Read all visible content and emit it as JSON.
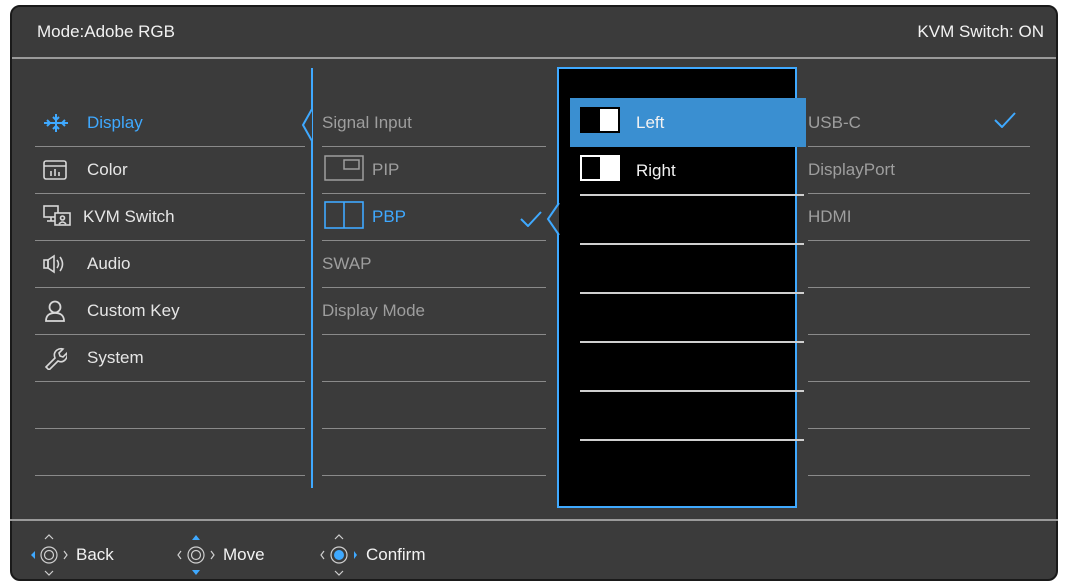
{
  "header": {
    "mode": "Mode:Adobe RGB",
    "kvm_status": "KVM Switch: ON"
  },
  "menu": [
    {
      "label": "Display",
      "icon": "display-icon",
      "active": true
    },
    {
      "label": "Color",
      "icon": "color-icon"
    },
    {
      "label": "KVM Switch",
      "icon": "kvm-switch-icon"
    },
    {
      "label": "Audio",
      "icon": "audio-icon"
    },
    {
      "label": "Custom Key",
      "icon": "user-icon"
    },
    {
      "label": "System",
      "icon": "wrench-icon"
    }
  ],
  "submenu": [
    {
      "label": "Signal Input"
    },
    {
      "label": "PIP",
      "icon": "pip-icon"
    },
    {
      "label": "PBP",
      "icon": "pbp-icon",
      "active": true,
      "checked": true
    },
    {
      "label": "SWAP"
    },
    {
      "label": "Display Mode"
    }
  ],
  "options": [
    {
      "label": "Left",
      "icon": "pbp-left-icon",
      "selected": true
    },
    {
      "label": "Right",
      "icon": "pbp-right-icon"
    }
  ],
  "sources": [
    {
      "label": "USB-C",
      "checked": true
    },
    {
      "label": "DisplayPort"
    },
    {
      "label": "HDMI"
    }
  ],
  "footer": {
    "back": "Back",
    "move": "Move",
    "confirm": "Confirm"
  },
  "colors": {
    "accent": "#3fa9ff",
    "panel": "#3b3b3b",
    "selected_row": "#3a8fd1"
  }
}
